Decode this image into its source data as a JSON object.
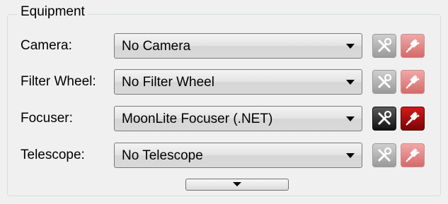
{
  "group": {
    "title": "Equipment"
  },
  "rows": [
    {
      "label": "Camera:",
      "value": "No Camera",
      "setup_icon": "setup-tools-icon",
      "connect_icon": "plug-connect-icon",
      "enabled": false
    },
    {
      "label": "Filter Wheel:",
      "value": "No Filter Wheel",
      "setup_icon": "setup-tools-icon",
      "connect_icon": "plug-connect-icon",
      "enabled": false
    },
    {
      "label": "Focuser:",
      "value": "MoonLite Focuser (.NET)",
      "setup_icon": "setup-tools-icon",
      "connect_icon": "plug-connect-icon",
      "enabled": true
    },
    {
      "label": "Telescope:",
      "value": "No Telescope",
      "setup_icon": "setup-tools-icon",
      "connect_icon": "plug-connect-icon",
      "enabled": false
    }
  ],
  "expand_button": {
    "icon": "chevron-down-icon"
  },
  "colors": {
    "background": "#f0f0f0",
    "groupbox_border": "#d5dfe5",
    "connect_enabled": "#b00e0e",
    "connect_disabled": "#e08a8a",
    "setup_enabled": "#222222",
    "setup_disabled": "#b4b4b4"
  }
}
